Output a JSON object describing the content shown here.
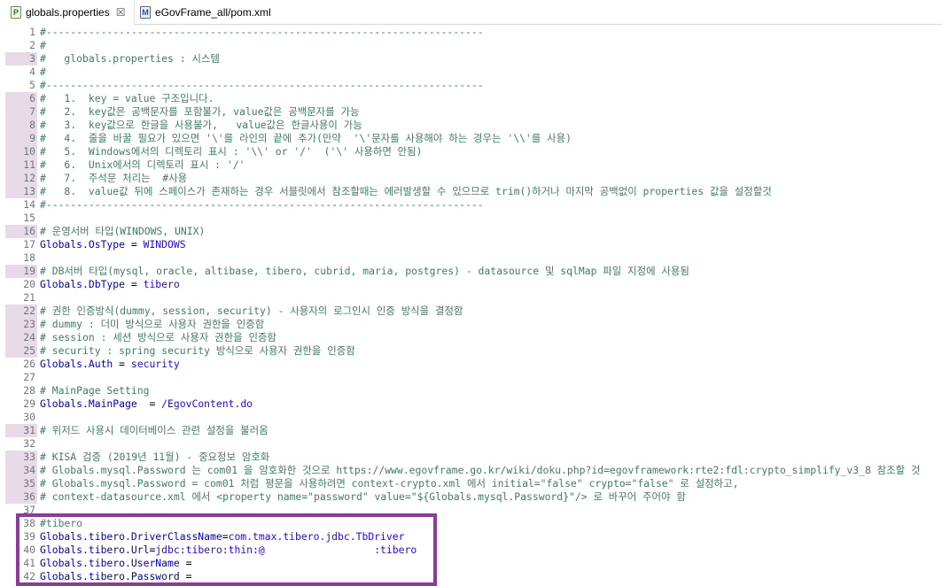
{
  "tabs": [
    {
      "label": "globals.properties",
      "icon": "properties-file-icon",
      "close": "☒"
    },
    {
      "label": "eGovFrame_all/pom.xml",
      "icon": "maven-pom-icon"
    }
  ],
  "lines": [
    {
      "n": "1",
      "hl": false,
      "t": "#------------------------------------------------------------------------"
    },
    {
      "n": "2",
      "hl": false,
      "t": "#"
    },
    {
      "n": "3",
      "hl": true,
      "t": "#   globals.properties : 시스템"
    },
    {
      "n": "4",
      "hl": false,
      "t": "#"
    },
    {
      "n": "5",
      "hl": false,
      "t": "#------------------------------------------------------------------------"
    },
    {
      "n": "6",
      "hl": true,
      "t": "#   1.  key = value 구조입니다."
    },
    {
      "n": "7",
      "hl": true,
      "t": "#   2.  key값은 공백문자를 포함불가, value값은 공백문자를 가능"
    },
    {
      "n": "8",
      "hl": true,
      "t": "#   3.  key값으로 한글을 사용불가,   value값은 한글사용이 가능"
    },
    {
      "n": "9",
      "hl": true,
      "t": "#   4.  줄을 바꿀 필요가 있으면 '\\'를 라인의 끝에 추가(만약  '\\'문자를 사용해야 하는 경우는 '\\\\'를 사용)"
    },
    {
      "n": "10",
      "hl": true,
      "t": "#   5.  Windows에서의 디렉토리 표시 : '\\\\' or '/'  ('\\' 사용하면 안됨)"
    },
    {
      "n": "11",
      "hl": true,
      "t": "#   6.  Unix에서의 디렉토리 표시 : '/'"
    },
    {
      "n": "12",
      "hl": true,
      "t": "#   7.  주석문 처리는  #사용"
    },
    {
      "n": "13",
      "hl": true,
      "t": "#   8.  value값 뒤에 스페이스가 존재하는 경우 서블릿에서 참조할때는 에러발생할 수 있으므로 trim()하거나 마지막 공백없이 properties 값을 설정할것"
    },
    {
      "n": "14",
      "hl": false,
      "t": "#------------------------------------------------------------------------"
    },
    {
      "n": "15",
      "hl": false,
      "t": ""
    },
    {
      "n": "16",
      "hl": true,
      "t": "# 운영서버 타입(WINDOWS, UNIX)"
    },
    {
      "n": "17",
      "hl": false,
      "k": "Globals.OsType",
      "v": "WINDOWS"
    },
    {
      "n": "18",
      "hl": false,
      "t": ""
    },
    {
      "n": "19",
      "hl": true,
      "t": "# DB서버 타입(mysql, oracle, altibase, tibero, cubrid, maria, postgres) - datasource 및 sqlMap 파일 지정에 사용됨"
    },
    {
      "n": "20",
      "hl": false,
      "k": "Globals.DbType",
      "v": "tibero"
    },
    {
      "n": "21",
      "hl": false,
      "t": ""
    },
    {
      "n": "22",
      "hl": true,
      "t": "# 권한 인증방식(dummy, session, security) - 사용자의 로그인시 인증 방식을 결정함"
    },
    {
      "n": "23",
      "hl": true,
      "t": "# dummy : 더미 방식으로 사용자 권한을 인증함"
    },
    {
      "n": "24",
      "hl": true,
      "t": "# session : 세션 방식으로 사용자 권한을 인증함"
    },
    {
      "n": "25",
      "hl": true,
      "t": "# security : spring security 방식으로 사용자 권한을 인증함"
    },
    {
      "n": "26",
      "hl": false,
      "k": "Globals.Auth",
      "v": "security"
    },
    {
      "n": "27",
      "hl": false,
      "t": ""
    },
    {
      "n": "28",
      "hl": false,
      "t": "# MainPage Setting"
    },
    {
      "n": "29",
      "hl": false,
      "k": "Globals.MainPage",
      "sep": "  = ",
      "v": "/EgovContent.do"
    },
    {
      "n": "30",
      "hl": false,
      "t": ""
    },
    {
      "n": "31",
      "hl": true,
      "t": "# 위저드 사용시 데이터베이스 관련 설정을 불러옴"
    },
    {
      "n": "32",
      "hl": false,
      "t": ""
    },
    {
      "n": "33",
      "hl": true,
      "t": "# KISA 검증 (2019년 11월) - 중요정보 암호화"
    },
    {
      "n": "34",
      "hl": true,
      "t": "# Globals.mysql.Password 는 com01 을 암호화한 것으로 https://www.egovframe.go.kr/wiki/doku.php?id=egovframework:rte2:fdl:crypto_simplify_v3_8 참조할 것"
    },
    {
      "n": "35",
      "hl": true,
      "t": "# Globals.mysql.Password = com01 처럼 평문을 사용하려면 context-crypto.xml 에서 initial=\"false\" crypto=\"false\" 로 설정하고,"
    },
    {
      "n": "36",
      "hl": true,
      "t": "# context-datasource.xml 에서 <property name=\"password\" value=\"${Globals.mysql.Password}\"/> 로 바꾸어 주어야 함"
    },
    {
      "n": "37",
      "hl": false,
      "t": ""
    },
    {
      "n": "38",
      "hl": false,
      "t": "#tibero"
    },
    {
      "n": "39",
      "hl": false,
      "k": "Globals.tibero.DriverClassName",
      "sep": "=",
      "v": "com.tmax.tibero.jdbc.TbDriver"
    },
    {
      "n": "40",
      "hl": false,
      "k": "Globals.tibero.Url",
      "sep": "=",
      "v": "jdbc:tibero:thin:@                  :tibero"
    },
    {
      "n": "41",
      "hl": false,
      "k": "Globals.tibero.UserName",
      "sep": " = ",
      "v": ""
    },
    {
      "n": "42",
      "hl": false,
      "k": "Globals.tibero.Password",
      "sep": " = ",
      "v": ""
    }
  ],
  "colors": {
    "comment": "#3f7f5f",
    "key": "#0000c0",
    "value": "#2a00ff",
    "highlight_box": "#8e3a9d",
    "line_marker": "#e8dbe8"
  }
}
